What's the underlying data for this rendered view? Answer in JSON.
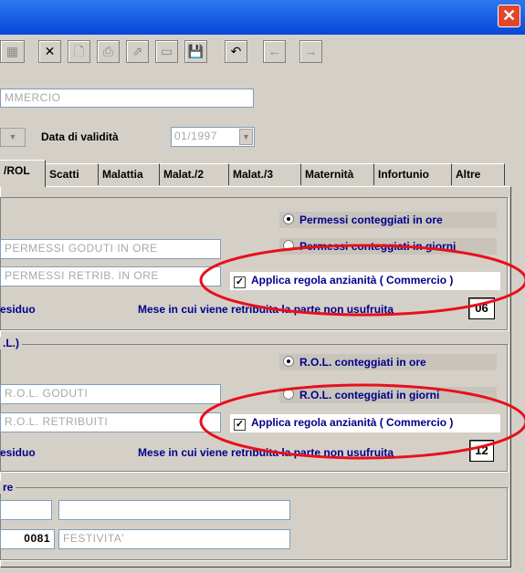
{
  "window": {
    "close_symbol": "✕"
  },
  "toolbar": {
    "buttons": [
      {
        "icon": "grid-icon",
        "glyph": "▦",
        "enabled": false
      },
      {
        "icon": "delete-icon",
        "glyph": "✕",
        "enabled": true
      },
      {
        "icon": "document-icon",
        "glyph": "🗋",
        "enabled": false
      },
      {
        "icon": "print-icon",
        "glyph": "⎙",
        "enabled": false
      },
      {
        "icon": "export-icon",
        "glyph": "⇗",
        "enabled": false
      },
      {
        "icon": "form-icon",
        "glyph": "▭",
        "enabled": false
      },
      {
        "icon": "save-icon",
        "glyph": "💾",
        "enabled": true
      },
      {
        "icon": "undo-icon",
        "glyph": "↶",
        "enabled": true
      },
      {
        "icon": "prev-arrow-icon",
        "glyph": "←",
        "enabled": false
      },
      {
        "icon": "next-arrow-icon",
        "glyph": "→",
        "enabled": false
      }
    ]
  },
  "header": {
    "contract_name": "MMERCIO",
    "validity_label": "Data di validità",
    "validity_value": "01/1997"
  },
  "tabs": [
    {
      "label": "/ROL",
      "active": true
    },
    {
      "label": "Scatti"
    },
    {
      "label": "Malattia"
    },
    {
      "label": "Malat./2"
    },
    {
      "label": "Malat./3"
    },
    {
      "label": "Maternità"
    },
    {
      "label": "Infortunio"
    },
    {
      "label": "Altre"
    }
  ],
  "permessi": {
    "radio_hours": "Permessi conteggiati in ore",
    "radio_days": "Permessi conteggiati in giorni",
    "field_goduti": "PERMESSI GODUTI IN ORE",
    "field_retrib": "PERMESSI RETRIB. IN ORE",
    "check_label": "Applica regola anzianità ( Commercio )",
    "residuo_label": "esiduo",
    "month_label": "Mese in cui viene retribuita la parte non usufruita",
    "month_value": "06"
  },
  "rol": {
    "group_title": ".L.)",
    "radio_hours": "R.O.L. conteggiati in ore",
    "radio_days": "R.O.L. conteggiati in giorni",
    "field_goduti": "R.O.L. GODUTI",
    "field_retrib": "R.O.L. RETRIBUITI",
    "check_label": "Applica regola anzianità ( Commercio )",
    "residuo_label": "esiduo",
    "month_label": "Mese in cui viene retribuita la parte non usufruita",
    "month_value": "12"
  },
  "altre": {
    "group_title": "re",
    "code_value": "0081",
    "desc_value": "FESTIVITA'"
  },
  "colors": {
    "annotation": "#e8101a",
    "titlebar": "#0a54e3"
  }
}
